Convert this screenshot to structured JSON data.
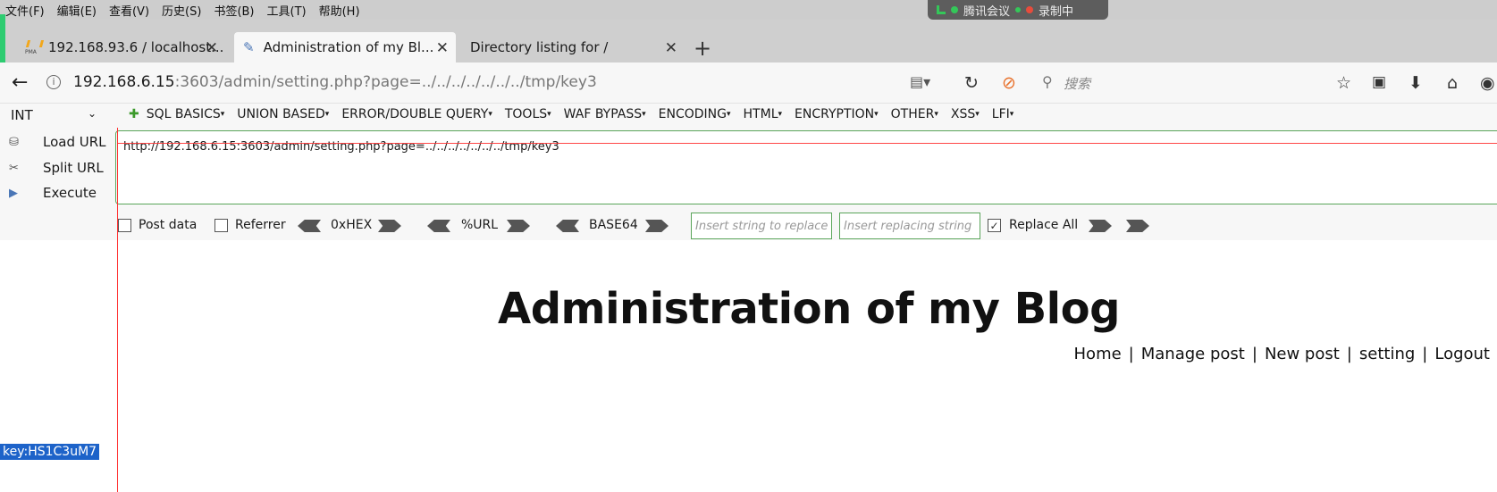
{
  "menubar": {
    "items": [
      "文件(F)",
      "编辑(E)",
      "查看(V)",
      "历史(S)",
      "书签(B)",
      "工具(T)",
      "帮助(H)"
    ],
    "meeting_label": "腾讯会议",
    "recording_label": "录制中"
  },
  "tabs": [
    {
      "title": "192.168.93.6 / localhost...",
      "icon": "phpmyadmin-icon"
    },
    {
      "title": "Administration of my Bl...",
      "icon": "pencil-icon"
    },
    {
      "title": "Directory listing for /",
      "icon": ""
    }
  ],
  "navbar": {
    "url_host": "192.168.6.15",
    "url_path": ":3603/admin/setting.php?page=../../../../../../../tmp/key3",
    "search_placeholder": "搜索"
  },
  "hackbar": {
    "select_value": "INT",
    "menu": [
      "SQL BASICS",
      "UNION BASED",
      "ERROR/DOUBLE QUERY",
      "TOOLS",
      "WAF BYPASS",
      "ENCODING",
      "HTML",
      "ENCRYPTION",
      "OTHER",
      "XSS",
      "LFI"
    ],
    "load_url": "Load URL",
    "split_url": "Split URL",
    "execute": "Execute",
    "url_value": "http://192.168.6.15:3603/admin/setting.php?page=../../../../../../../tmp/key3",
    "post_data": "Post data",
    "referrer": "Referrer",
    "hex": "0xHEX",
    "urlenc": "%URL",
    "base64": "BASE64",
    "insert_replace_ph": "Insert string to replace",
    "insert_replacing_ph": "Insert replacing string",
    "replace_all": "Replace All"
  },
  "page": {
    "title": "Administration of my Blog",
    "nav": [
      "Home",
      "Manage post",
      "New post",
      "setting",
      "Logout"
    ],
    "key_text": "key:HS1C3uM7"
  }
}
